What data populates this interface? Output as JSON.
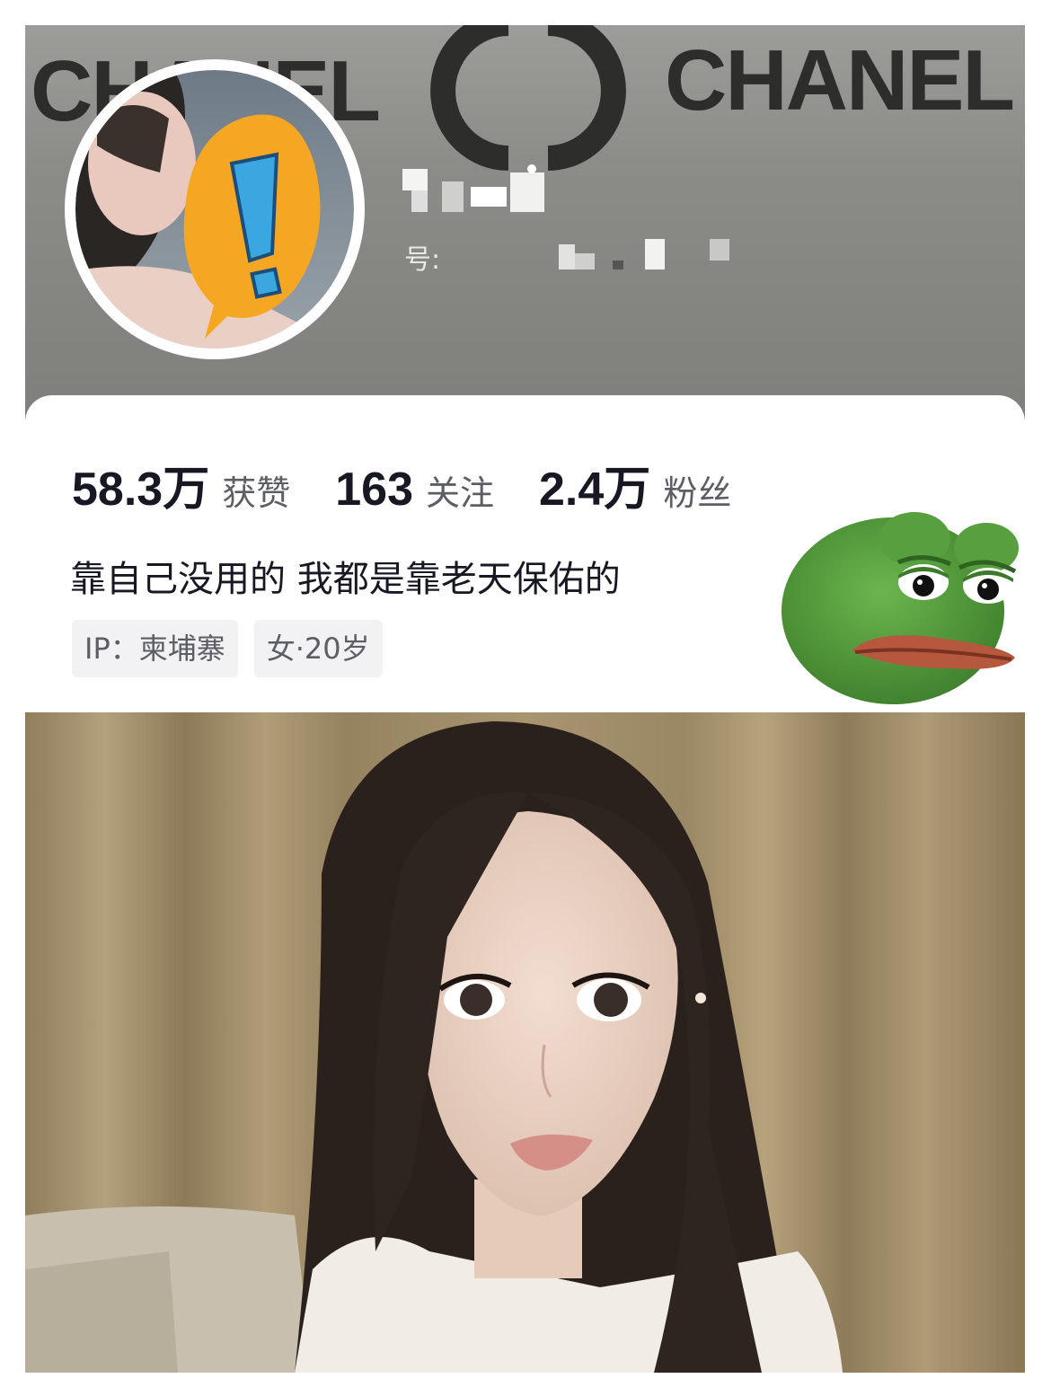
{
  "banner": {
    "brand_left": "CHANEL",
    "brand_right": "CHANEL",
    "account_id_prefix": "号:"
  },
  "stats": {
    "likes_value": "58.3万",
    "likes_label": "获赞",
    "following_value": "163",
    "following_label": "关注",
    "followers_value": "2.4万",
    "followers_label": "粉丝"
  },
  "bio": "靠自己没用的 我都是靠老天保佑的",
  "tags": {
    "ip": "IP：柬埔寨",
    "gender_age": "女·20岁"
  },
  "colors": {
    "banner": "#8b8b87",
    "stat_number": "#161823",
    "stat_label": "#5c5e66",
    "tag_bg": "#f2f2f4",
    "warning_orange": "#f5a623",
    "warning_blue": "#3aa7e0",
    "pepe_green": "#4f9a3a"
  },
  "icons": [
    "chanel-cc-logo",
    "warning-exclamation-sticker",
    "pepe-frog-sticker"
  ]
}
